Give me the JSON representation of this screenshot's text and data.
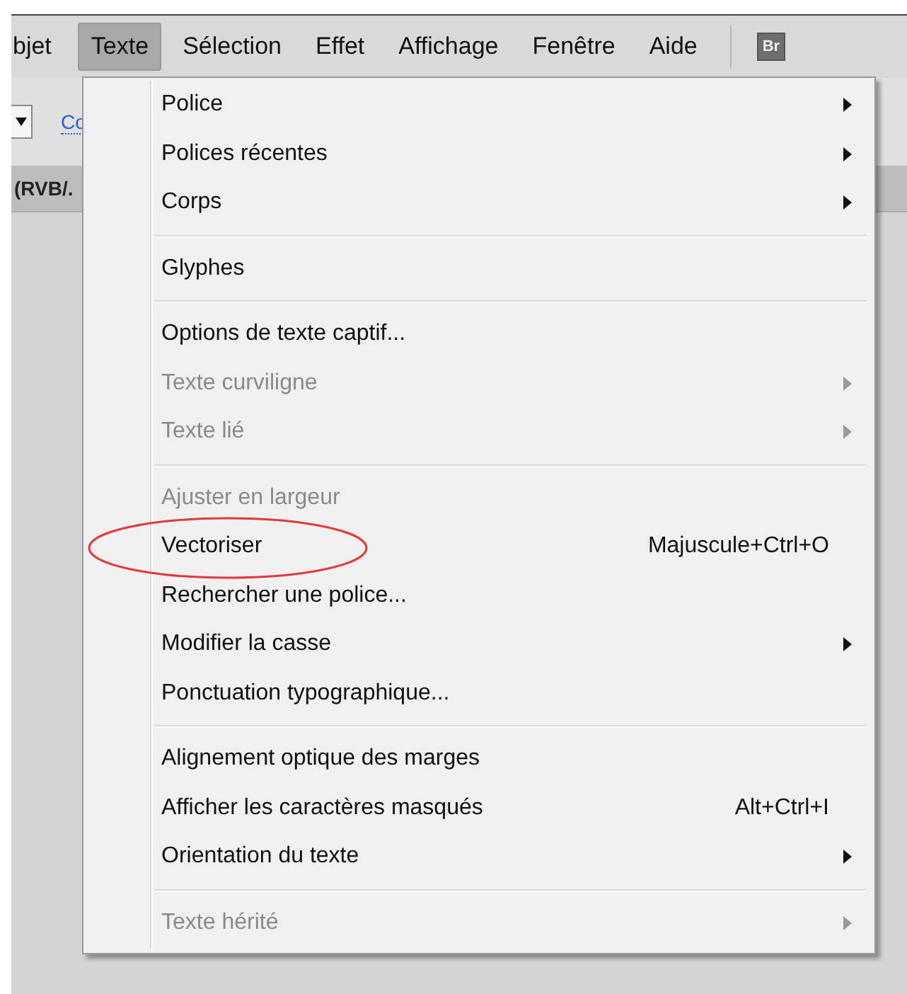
{
  "menu_bar": {
    "items": [
      {
        "label": "bjet",
        "selected": false
      },
      {
        "label": "Texte",
        "selected": true
      },
      {
        "label": "Sélection",
        "selected": false
      },
      {
        "label": "Effet",
        "selected": false
      },
      {
        "label": "Affichage",
        "selected": false
      },
      {
        "label": "Fenêtre",
        "selected": false
      },
      {
        "label": "Aide",
        "selected": false
      }
    ],
    "badge": "Br"
  },
  "toolbar": {
    "link": "Co"
  },
  "document_tab": {
    "label": "(RVB/."
  },
  "menu": {
    "items": [
      {
        "kind": "item",
        "label": "Police",
        "submenu": true,
        "disabled": false
      },
      {
        "kind": "item",
        "label": "Polices récentes",
        "submenu": true,
        "disabled": false
      },
      {
        "kind": "item",
        "label": "Corps",
        "submenu": true,
        "disabled": false
      },
      {
        "kind": "separator"
      },
      {
        "kind": "item",
        "label": "Glyphes",
        "submenu": false,
        "disabled": false
      },
      {
        "kind": "separator"
      },
      {
        "kind": "item",
        "label": "Options de texte captif...",
        "submenu": false,
        "disabled": false
      },
      {
        "kind": "item",
        "label": "Texte curviligne",
        "submenu": true,
        "disabled": true
      },
      {
        "kind": "item",
        "label": "Texte lié",
        "submenu": true,
        "disabled": true
      },
      {
        "kind": "separator"
      },
      {
        "kind": "item",
        "label": "Ajuster en largeur",
        "submenu": false,
        "disabled": true
      },
      {
        "kind": "item",
        "label": "Vectoriser",
        "shortcut": "Majuscule+Ctrl+O",
        "submenu": false,
        "disabled": false,
        "circled": true
      },
      {
        "kind": "item",
        "label": "Rechercher une police...",
        "submenu": false,
        "disabled": false
      },
      {
        "kind": "item",
        "label": "Modifier la casse",
        "submenu": true,
        "disabled": false
      },
      {
        "kind": "item",
        "label": "Ponctuation typographique...",
        "submenu": false,
        "disabled": false
      },
      {
        "kind": "separator"
      },
      {
        "kind": "item",
        "label": "Alignement optique des marges",
        "submenu": false,
        "disabled": false
      },
      {
        "kind": "item",
        "label": "Afficher les caractères masqués",
        "shortcut": "Alt+Ctrl+I",
        "submenu": false,
        "disabled": false
      },
      {
        "kind": "item",
        "label": "Orientation du texte",
        "submenu": true,
        "disabled": false
      },
      {
        "kind": "separator"
      },
      {
        "kind": "item",
        "label": "Texte hérité",
        "submenu": true,
        "disabled": true
      }
    ]
  }
}
